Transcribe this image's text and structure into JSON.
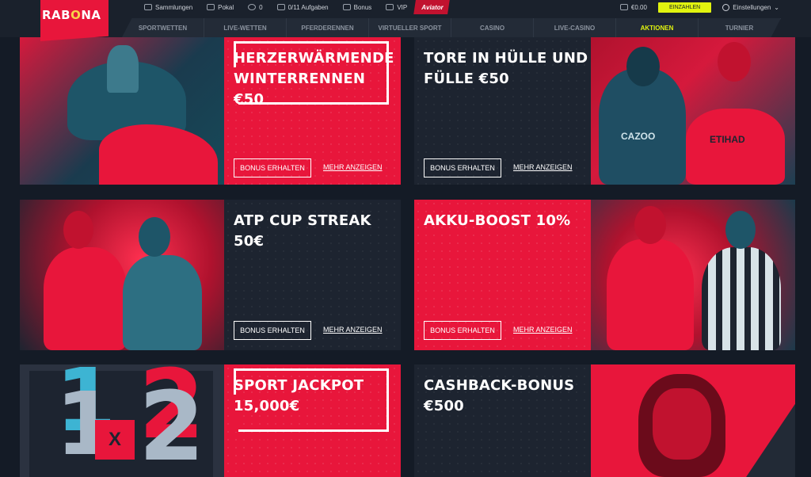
{
  "brand": {
    "logo_text_a": "RAB",
    "logo_text_b": "O",
    "logo_text_c": "NA"
  },
  "topmenu": [
    {
      "label": "Sammlungen",
      "icon": "collection-icon"
    },
    {
      "label": "Pokal",
      "icon": "trophy-icon"
    },
    {
      "label": "0",
      "icon": "coin-icon"
    },
    {
      "label": "0/11 Aufgaben",
      "icon": "flag-icon"
    },
    {
      "label": "Bonus",
      "icon": "gift-icon"
    },
    {
      "label": "VIP",
      "icon": "diamond-icon"
    }
  ],
  "aviator": "Aviator",
  "balance": "€0.00",
  "deposit": "EINZAHLEN",
  "settings": "Einstellungen",
  "nav": [
    "SPORTWETTEN",
    "LIVE-WETTEN",
    "PFERDERENNEN",
    "VIRTUELLER SPORT",
    "CASINO",
    "LIVE-CASINO",
    "AKTIONEN",
    "TURNIER"
  ],
  "active_nav": "AKTIONEN",
  "accent": "#e8163b",
  "promos": [
    {
      "title_l1": "HERZERWÄRMENDE",
      "title_l2": "WINTERRENNEN",
      "title_l3": "€50",
      "button": "BONUS ERHALTEN",
      "more": "MEHR ANZEIGEN"
    },
    {
      "title_l1": "TORE IN HÜLLE UND",
      "title_l2": "FÜLLE €50",
      "button": "BONUS ERHALTEN",
      "more": "MEHR ANZEIGEN"
    },
    {
      "title_l1": "ATP CUP STREAK 50€",
      "button": "BONUS ERHALTEN",
      "more": "MEHR ANZEIGEN"
    },
    {
      "title_l1": "AKKU-BOOST 10%",
      "button": "BONUS ERHALTEN",
      "more": "MEHR ANZEIGEN"
    },
    {
      "title_l1": "SPORT JACKPOT",
      "title_l2": "15,000€"
    },
    {
      "title_l1": "CASHBACK-BONUS",
      "title_l2": "€500"
    }
  ],
  "jackpot_symbols": [
    "1",
    "X",
    "2"
  ],
  "jersey_texts": [
    "CAZOO",
    "ETIHAD"
  ]
}
